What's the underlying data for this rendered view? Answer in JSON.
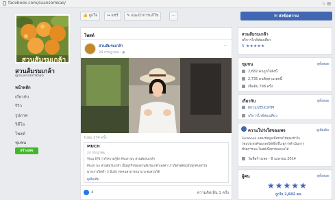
{
  "browser": {
    "url": "facebook.com/suansomkao/"
  },
  "sidebar": {
    "page_name": "สวนส้มรมเกล้า",
    "handle": "@suansomklao",
    "cover_text": "สวนส้มรมเกล้า",
    "items": [
      {
        "label": "หน้าหลัก",
        "active": true
      },
      {
        "label": "เกี่ยวกับ",
        "active": false
      },
      {
        "label": "รีวิว",
        "active": false
      },
      {
        "label": "รูปภาพ",
        "active": false
      },
      {
        "label": "วิดีโอ",
        "active": false
      },
      {
        "label": "โพสต์",
        "active": false
      },
      {
        "label": "ชุมชน",
        "active": false
      }
    ],
    "create_label": "สร้างเพจ"
  },
  "actions": {
    "like": "ถูกใจ",
    "share": "แชร์",
    "suggest": "แนะนำการแก้ไข",
    "more": "···",
    "send": "ส่งข้อความ"
  },
  "post": {
    "section_title": "โพสต์",
    "author": "สวนส้มรมเกล้า",
    "time": "24 กรกฎาคม",
    "views": "รับชม 274 ครั้ง",
    "link": {
      "title": "MUCH",
      "date": "24 กรกฎาคม",
      "line1": "Vlog EP1 | ทำความรู้จัก Much by สวนส้มรมเกล้า",
      "line2": "Much by สวนส้มรมเกล้า เป็นธุรกิจของสวนส้มรมเกล้าเองค่า เราเปิดรอต้อนรับทุกคนทุกวัน",
      "line3": "พวกเราเปิดทำ 5 ปีแล้ว ทุกคนสามารถมาแวะชมสวนได้",
      "more": "ดูเพิ่มเติม"
    },
    "reactions": "4",
    "stats": "ความคิดเห็น 1 ครั้ง"
  },
  "community": {
    "title": "สวนส้มรมเกล้า",
    "subtitle": "บริการไกด์ท่องเที่ยว",
    "rating_text": "5 ★★★★★"
  },
  "community_stats": {
    "title": "ชุมชน",
    "see_all": "ดูทั้งหมด",
    "likes": "2,682 คนถูกใจสิ่งนี้",
    "follows": "2,735 คนติดตามเพจนี้",
    "checkins": "เช็คอิน 798 ครั้ง"
  },
  "about": {
    "title": "เกี่ยวกับ",
    "see_all": "ดูทั้งหมด",
    "link": "bit.ly/2EULSHM",
    "category": "บริการไกด์ท่องเที่ยว"
  },
  "transparency": {
    "title": "ความโปร่งใสของเพจ",
    "see_all": "ดูเพิ่มเติม",
    "line1": "Facebook แสดงข้อมูลเพื่อช่วยให้คุณเข้าใจ",
    "line2": "วัตถุประสงค์ของเพจได้ดียิ่งขึ้น ดูการดำเนินการ",
    "line3": "ที่จัดการและโพสต์เนื้อหาของเพจได้",
    "created": "วันที่สร้างเพจ - 8 เมษายน 2014"
  },
  "reviews": {
    "title": "ผู้คน",
    "see_all": "ดูทั้งหมด",
    "stars": "★★★★★",
    "count_label": "ถูกใจ 2,682 คน"
  },
  "colors": {
    "accent": "#4267b2",
    "link": "#385898",
    "bg": "#e9ebee"
  }
}
